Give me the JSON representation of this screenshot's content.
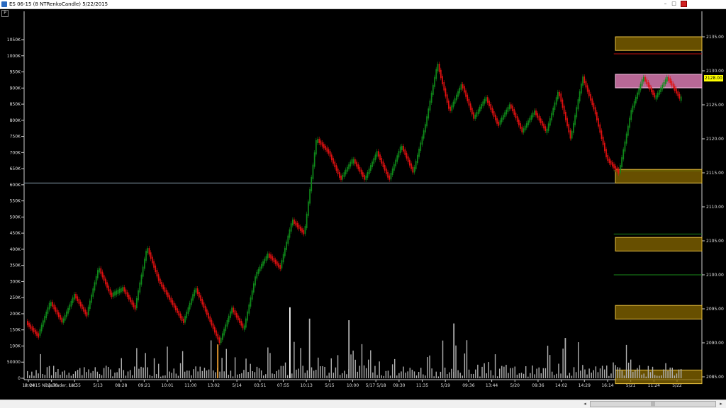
{
  "window": {
    "title": "ES 06-15 (8 NTRenkoCandle)  5/22/2015",
    "minimize_glyph": "–",
    "maximize_glyph": "□",
    "panel_label": "P"
  },
  "copyright": "© 2015 NinjaTrader, LLC",
  "current_price_label": "2128.00",
  "scrollbar": {
    "left_arrow": "◂",
    "right_arrow": "▸",
    "grip": "|||"
  },
  "colors": {
    "up": "#0f8a1a",
    "down": "#e01010",
    "zone": "#8a6a00",
    "zone_border": "#e8c040",
    "highlight_zone": "#d87ab0",
    "red_line": "#c01010",
    "green_line": "#1a8a1a",
    "hline": "#8aa0b0",
    "volume": "#b0b0b0"
  },
  "chart_data": {
    "type": "candlestick",
    "price_axis": {
      "ticks": [
        "2135.00",
        "2130.00",
        "2125.00",
        "2120.00",
        "2115.00",
        "2110.00",
        "2105.00",
        "2100.00",
        "2095.00",
        "2090.00",
        "2085.00"
      ],
      "ylim": [
        2084,
        2137.5
      ]
    },
    "volume_axis": {
      "ticks": [
        "1050K",
        "1000K",
        "950K",
        "900K",
        "850K",
        "800K",
        "750K",
        "700K",
        "650K",
        "600K",
        "550K",
        "500K",
        "450K",
        "400K",
        "350K",
        "300K",
        "250K",
        "200K",
        "150K",
        "100K",
        "50000",
        "0"
      ],
      "ylim": [
        0,
        1050000
      ]
    },
    "time_axis": [
      "12:04",
      "13:36",
      "14:55",
      "5/13",
      "08:28",
      "09:21",
      "10:01",
      "11:00",
      "13:02",
      "5/14",
      "03:51",
      "07:55",
      "10:13",
      "5/15",
      "10:00",
      "5/17 5/18",
      "09:30",
      "11:35",
      "5/19",
      "09:36",
      "13:44",
      "5/20",
      "09:36",
      "14:02",
      "14:29",
      "16:14",
      "5/21",
      "11:24",
      "5/22"
    ],
    "close_path": [
      2093,
      2091,
      2096,
      2093,
      2097,
      2094,
      2101,
      2097,
      2098,
      2095,
      2104,
      2099,
      2096,
      2093,
      2098,
      2094,
      2090,
      2095,
      2092,
      2100,
      2103,
      2101,
      2108,
      2106,
      2120,
      2118,
      2114,
      2117,
      2114,
      2118,
      2114,
      2119,
      2115,
      2122,
      2131,
      2124,
      2128,
      2123,
      2126,
      2122,
      2125,
      2121,
      2124,
      2121,
      2127,
      2120,
      2129,
      2124,
      2117,
      2115,
      2124,
      2129,
      2126,
      2129,
      2126
    ],
    "zones": [
      {
        "kind": "resistance",
        "top": 2135.0,
        "bottom": 2133.0
      },
      {
        "kind": "current",
        "top": 2129.5,
        "bottom": 2127.5
      },
      {
        "kind": "support",
        "top": 2115.5,
        "bottom": 2113.5
      },
      {
        "kind": "support",
        "top": 2105.5,
        "bottom": 2103.5
      },
      {
        "kind": "support",
        "top": 2095.5,
        "bottom": 2093.5
      },
      {
        "kind": "support",
        "top": 2086.0,
        "bottom": 2084.0
      }
    ],
    "lines": [
      {
        "kind": "red",
        "price": 2132.5,
        "x_start_fraction": 0.87
      },
      {
        "kind": "green",
        "price": 2115.3,
        "x_start_fraction": 0.87
      },
      {
        "kind": "green",
        "price": 2106.0,
        "x_start_fraction": 0.87
      },
      {
        "kind": "green",
        "price": 2100.0,
        "x_start_fraction": 0.87
      },
      {
        "kind": "horizontal",
        "price": 2113.5,
        "x_start_fraction": 0.0
      }
    ],
    "volume_spikes": [
      {
        "bar_fraction": 0.4,
        "value": 220000,
        "color": "#ffffff"
      },
      {
        "bar_fraction": 0.29,
        "value": 105000,
        "color": "#f0a030"
      },
      {
        "bar_fraction": 0.43,
        "value": 185000,
        "color": "#b0b0b0"
      },
      {
        "bar_fraction": 0.49,
        "value": 180000,
        "color": "#b0b0b0"
      },
      {
        "bar_fraction": 0.65,
        "value": 170000,
        "color": "#b0b0b0"
      },
      {
        "bar_fraction": 0.82,
        "value": 125000,
        "color": "#b0b0b0"
      }
    ]
  }
}
